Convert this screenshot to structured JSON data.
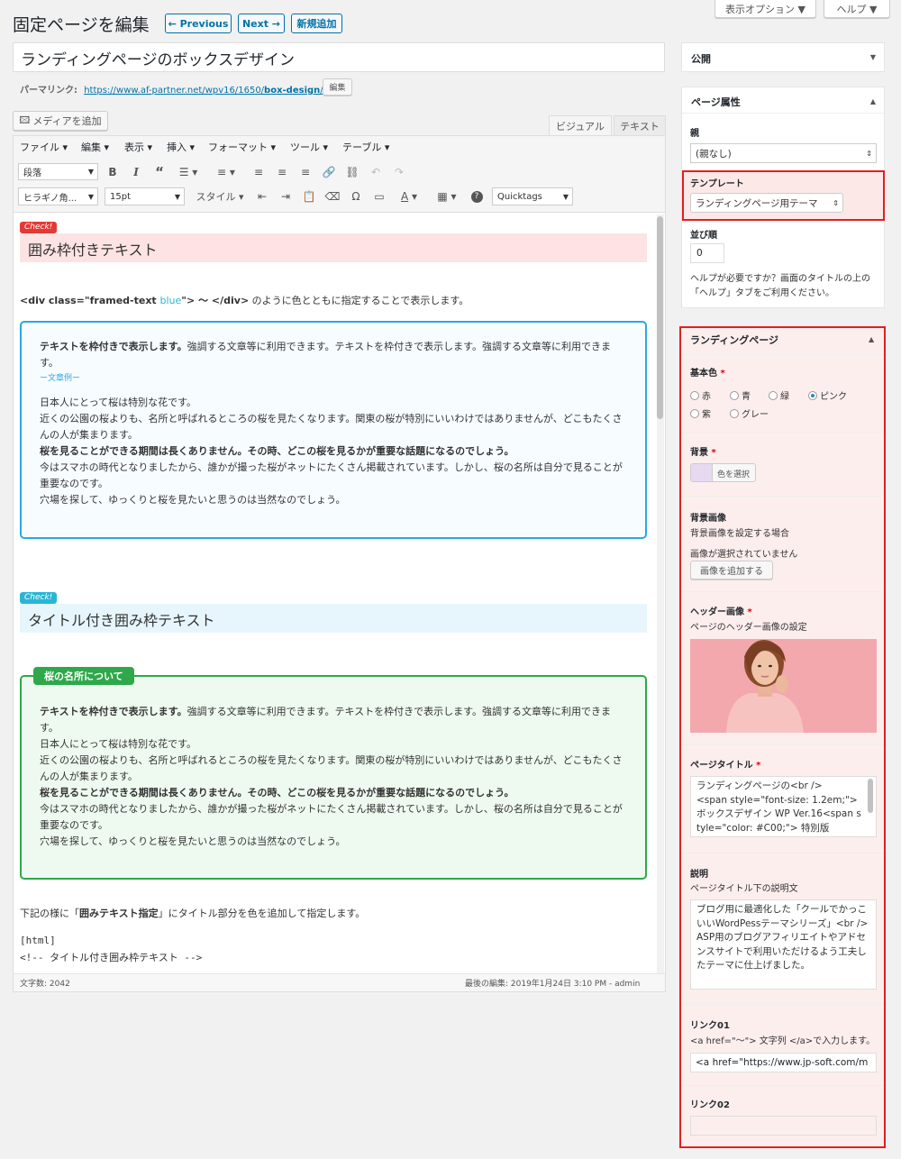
{
  "header": {
    "title": "固定ページを編集",
    "prev": "← Previous",
    "next": "Next →",
    "add_new": "新規追加",
    "display_options": "表示オプション ▼",
    "help": "ヘルプ ▼"
  },
  "post": {
    "title": "ランディングページのボックスデザイン",
    "permalink_label": "パーマリンク:",
    "permalink_base": "https://www.af-partner.net/wpv16/1650/",
    "permalink_slug": "box-design",
    "permalink_end": "/",
    "edit": "編集"
  },
  "editor": {
    "add_media": "メディアを追加",
    "tab_visual": "ビジュアル",
    "tab_text": "テキスト",
    "menu": [
      "ファイル ▾",
      "編集 ▾",
      "表示 ▾",
      "挿入 ▾",
      "フォーマット ▾",
      "ツール ▾",
      "テーブル ▾"
    ],
    "format_select": "段落",
    "font_select": "ヒラギノ角...",
    "size_select": "15pt",
    "style_select": "スタイル ▾",
    "quicktags": "Quicktags",
    "word_count": "文字数: 2042",
    "last_edit": "最後の編集: 2019年1月24日 3:10 PM - admin"
  },
  "content": {
    "check1": "Check!",
    "heading1": "囲み枠付きテキスト",
    "code_pre": "<div class=\"framed-text ",
    "code_blue": "blue",
    "code_post": "\"> ～ </div>",
    "code_tail": " のように色とともに指定することで表示します。",
    "box1_bold": "テキストを枠付きで表示します。",
    "box1_rest": "強調する文章等に利用できます。テキストを枠付きで表示します。強調する文章等に利用できます。",
    "example": "ー文章例ー",
    "p1": "日本人にとって桜は特別な花です。",
    "p2": "近くの公園の桜よりも、名所と呼ばれるところの桜を見たくなります。関東の桜が特別にいいわけではありませんが、どこもたくさんの人が集まります。",
    "p3": "桜を見ることができる期間は長くありません。その時、どこの桜を見るかが重要な話題になるのでしょう。",
    "p4": "今はスマホの時代となりましたから、誰かが撮った桜がネットにたくさん掲載されています。しかし、桜の名所は自分で見ることが重要なのです。",
    "p5": "穴場を探して、ゆっくりと桜を見たいと思うのは当然なのでしょう。",
    "check2": "Check!",
    "heading2": "タイトル付き囲み枠テキスト",
    "box2_title": "桜の名所について",
    "note_pre": "下記の様に「",
    "note_bold": "囲みテキスト指定",
    "note_post": "」にタイトル部分を色を追加して指定します。",
    "html_tag": "[html]",
    "html_comment": "<!-- タイトル付き囲み枠テキスト -->"
  },
  "sidebar": {
    "publish": "公開",
    "page_attr": {
      "title": "ページ属性",
      "parent_label": "親",
      "parent_value": "(親なし)",
      "template_label": "テンプレート",
      "template_value": "ランディングページ用テーマ",
      "order_label": "並び順",
      "order_value": "0",
      "help": "ヘルプが必要ですか？画面のタイトルの上の「ヘルプ」タブをご利用ください。"
    },
    "landing": {
      "title": "ランディングページ",
      "base_color_label": "基本色",
      "required": "*",
      "colors": [
        "赤",
        "青",
        "緑",
        "ピンク",
        "紫",
        "グレー"
      ],
      "selected_color": "ピンク",
      "bg_label": "背景",
      "bg_button": "色を選択",
      "bg_color": "#e8d9f2",
      "bg_image_label": "背景画像",
      "bg_image_desc": "背景画像を設定する場合",
      "bg_image_none": "画像が選択されていません",
      "bg_image_button": "画像を追加する",
      "header_image_label": "ヘッダー画像",
      "header_image_desc": "ページのヘッダー画像の設定",
      "page_title_label": "ページタイトル",
      "page_title_value": "ランディングページの<br />\n<span style=\"font-size: 1.2em;\">ボックスデザイン WP Ver.16<span style=\"color: #C00;\"> 特別版",
      "desc_label": "説明",
      "desc_desc": "ページタイトル下の説明文",
      "desc_value": "ブログ用に最適化した「クールでかっこいいWordPessテーマシリーズ」<br />\nASP用のブログアフィリエイトやアドセンスサイトで利用いただけるよう工夫したテーマに仕上げました。",
      "link1_label": "リンク01",
      "link1_desc": "<a href=\"～\"> 文字列 </a>で入力します。",
      "link1_value": "<a href=\"https://www.jp-soft.com/m",
      "link2_label": "リンク02"
    }
  },
  "colors": {
    "accent": "#0073aa",
    "highlight_red": "#e02020",
    "check_red": "#e53935",
    "check_cyan": "#29b6d6",
    "box_blue": "#2aa8e0",
    "box_green": "#2ea84a"
  }
}
